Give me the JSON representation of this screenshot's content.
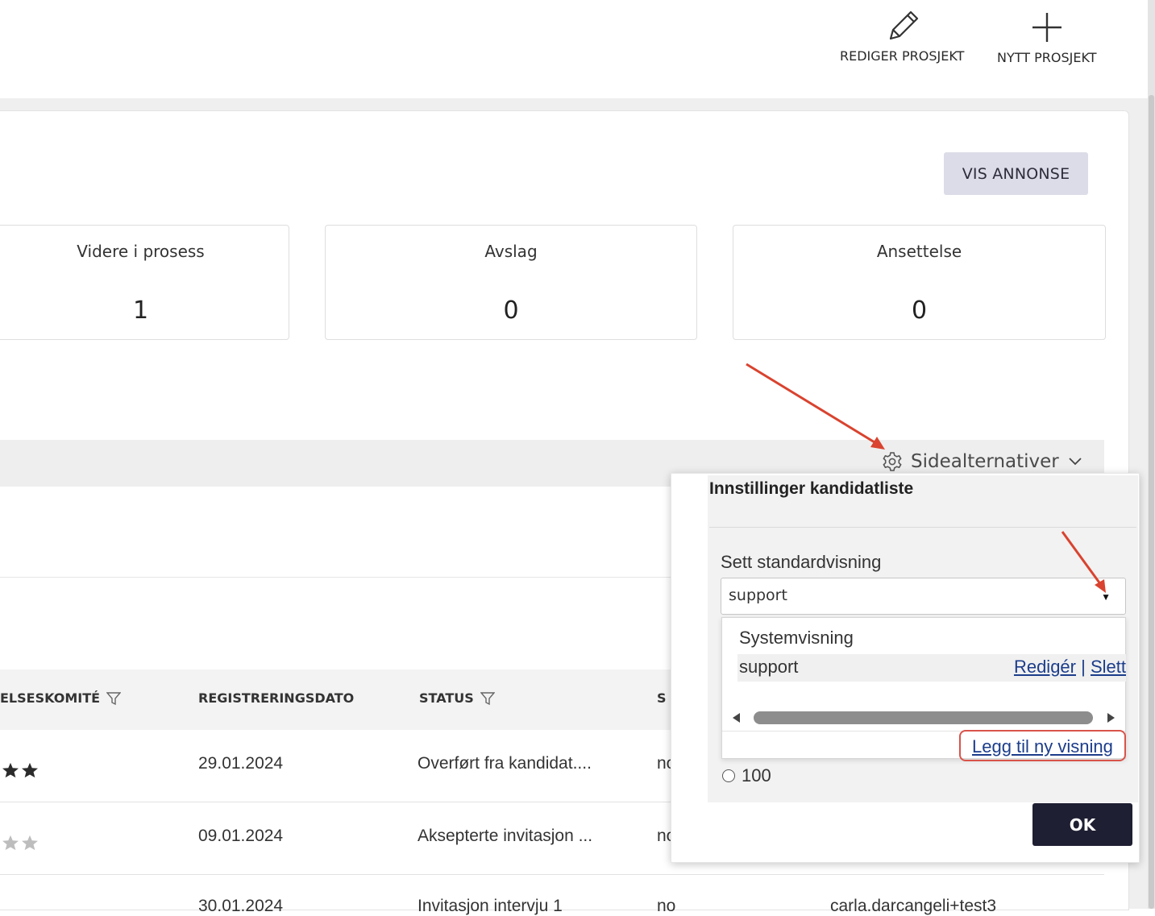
{
  "toolbar": {
    "edit_label": "REDIGER PROSJEKT",
    "new_label": "NYTT PROSJEKT"
  },
  "ad_button": "VIS ANNONSE",
  "stats": [
    {
      "title": "Videre i prosess",
      "value": "1"
    },
    {
      "title": "Avslag",
      "value": "0"
    },
    {
      "title": "Ansettelse",
      "value": "0"
    }
  ],
  "page_options": {
    "label": "Sidealternativer"
  },
  "table": {
    "headers": [
      "ELSESKOMITÉ",
      "REGISTRERINGSDATO",
      "STATUS",
      "S"
    ],
    "rows": [
      {
        "date": "29.01.2024",
        "status": "Overført fra kandidat....",
        "col4": "no",
        "stars_filled": 2
      },
      {
        "date": "09.01.2024",
        "status": "Aksepterte invitasjon ...",
        "col4": "no",
        "stars_filled": 0
      },
      {
        "date": "30.01.2024",
        "status": "Invitasjon intervju 1",
        "col4": "no",
        "col5": "carla.darcangeli+test3"
      }
    ]
  },
  "settings_popup": {
    "title": "Innstillinger kandidatliste",
    "default_view_label": "Sett standardvisning",
    "selected_view": "support",
    "options": [
      {
        "label": "Systemvisning"
      },
      {
        "label": "support",
        "edit": "Redigér",
        "separator": "|",
        "delete": "Slett"
      }
    ],
    "add_view": "Legg til ny visning",
    "page_size_option": "100",
    "ok": "OK"
  },
  "colors": {
    "accent_dark": "#1f1f33",
    "link": "#1c3d8b",
    "highlight_red": "#d9534a",
    "annotation_arrow": "#d9432f"
  }
}
